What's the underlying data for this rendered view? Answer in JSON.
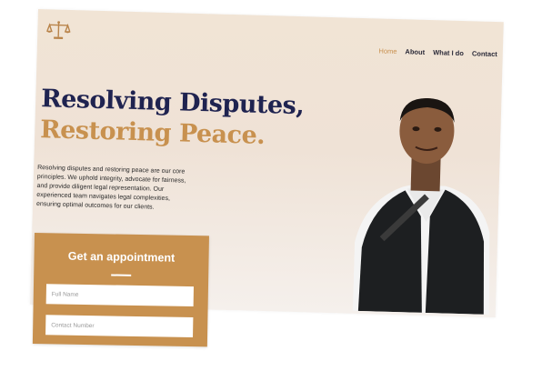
{
  "nav": {
    "items": [
      "Home",
      "About",
      "What I do",
      "Contact"
    ]
  },
  "hero": {
    "headline_line1": "Resolving Disputes,",
    "headline_line2": "Restoring Peace.",
    "description": "Resolving disputes and restoring peace are our core principles. We uphold integrity, advocate for fairness, and provide diligent legal representation. Our experienced team navigates legal complexities, ensuring optimal outcomes for our clients."
  },
  "appointment": {
    "title": "Get an appointment",
    "full_name_placeholder": "Full Name",
    "contact_number_placeholder": "Contact Number"
  },
  "icons": {
    "logo": "scales-of-justice-icon"
  },
  "colors": {
    "accent": "#c8914f",
    "navy": "#1f2350",
    "background_top": "#f1e4d5",
    "background_bottom": "#f5f0ec"
  }
}
